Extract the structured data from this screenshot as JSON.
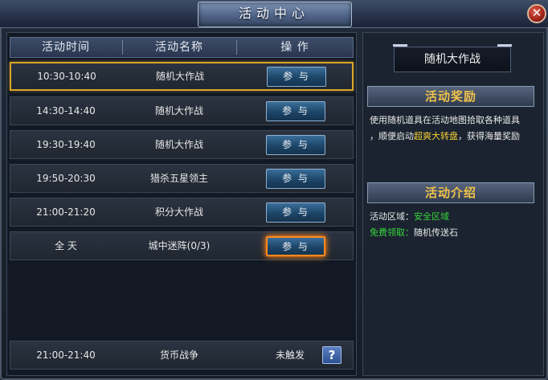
{
  "window": {
    "title": "活动中心",
    "close_label": "✕"
  },
  "table": {
    "headers": [
      "活动时间",
      "活动名称",
      "操 作"
    ],
    "rows": [
      {
        "time": "10:30-10:40",
        "name": "随机大作战",
        "action": "参 与"
      },
      {
        "time": "14:30-14:40",
        "name": "随机大作战",
        "action": "参 与"
      },
      {
        "time": "19:30-19:40",
        "name": "随机大作战",
        "action": "参 与"
      },
      {
        "time": "19:50-20:30",
        "name": "猎杀五星领主",
        "action": "参 与"
      },
      {
        "time": "21:00-21:20",
        "name": "积分大作战",
        "action": "参 与"
      },
      {
        "time": "全 天",
        "name": "城中迷阵(0/3)",
        "action": "参 与"
      }
    ],
    "footer_row": {
      "time": "21:00-21:40",
      "name": "货币战争",
      "status": "未触发",
      "help_label": "?"
    }
  },
  "detail": {
    "event_name": "随机大作战",
    "reward_header": "活动奖励",
    "reward_line1": "使用随机道具在活动地图拾取各种道具",
    "reward_line2_pre": "，顺便启动",
    "reward_line2_highlight": "超爽大转盘",
    "reward_line2_post": "，获得海量奖励",
    "intro_header": "活动介绍",
    "area_label": "活动区域：",
    "area_value": "安全区域",
    "free_label": "免费领取：",
    "free_value": "随机传送石"
  },
  "colors": {
    "accent_gold": "#f0c24a",
    "highlight_yellow": "#f5d033",
    "highlight_green": "#37d93a",
    "selected_border": "#d9a629"
  }
}
